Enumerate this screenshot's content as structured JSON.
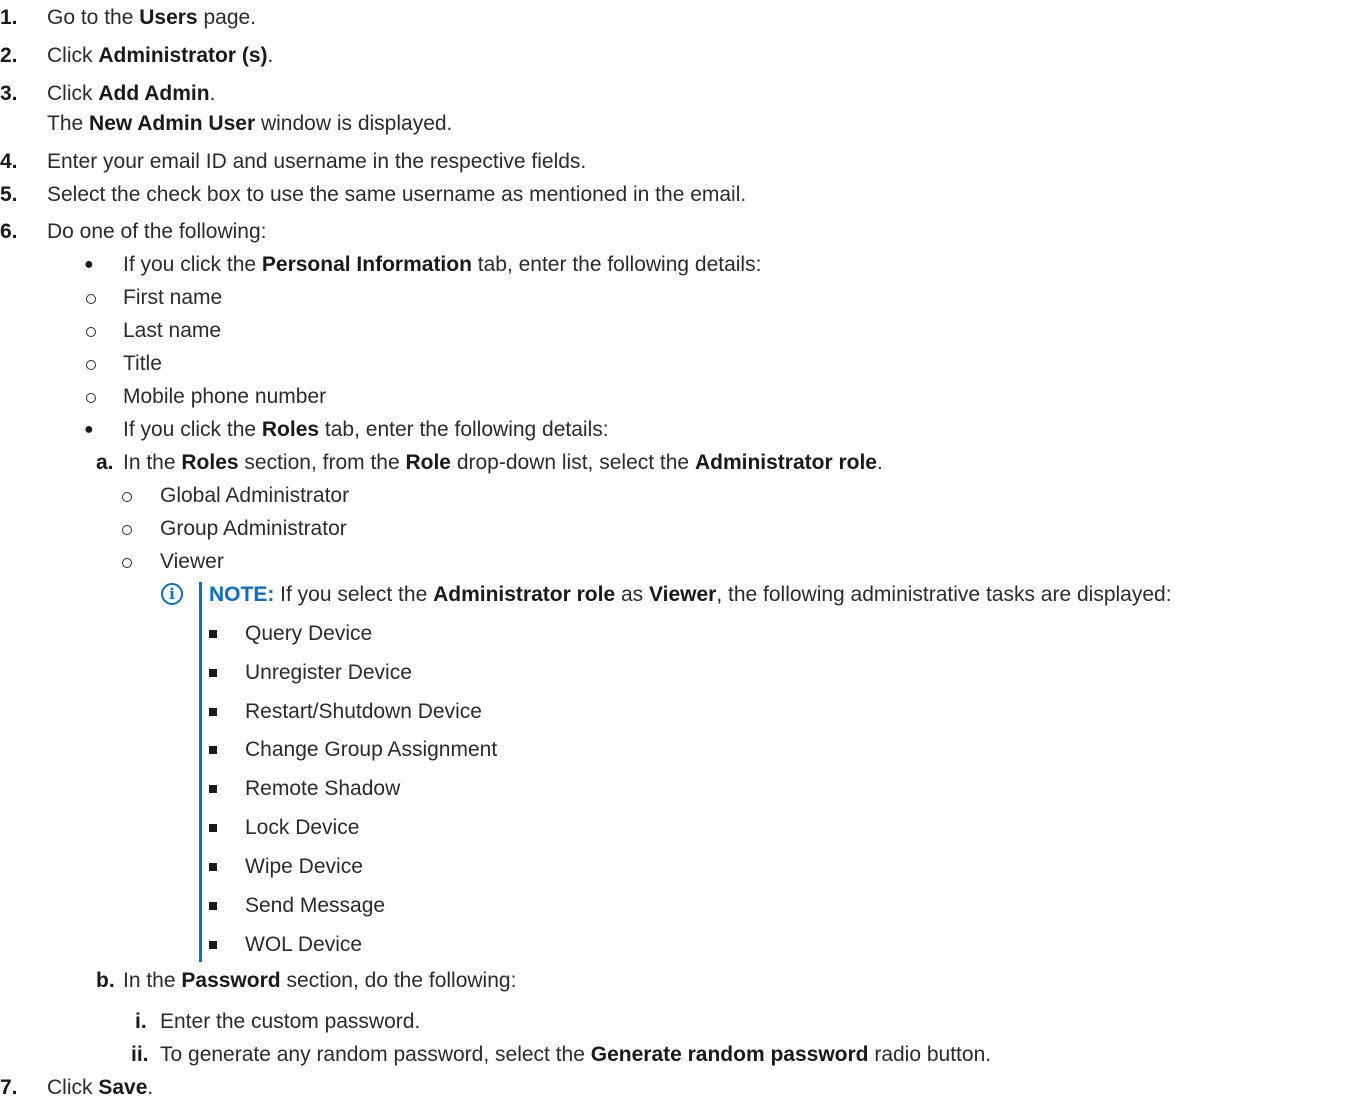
{
  "steps": {
    "s1": {
      "num": "1.",
      "pre": "Go to the ",
      "b1": "Users",
      "post": " page."
    },
    "s2": {
      "num": "2.",
      "pre": "Click ",
      "b1": "Administrator (s)",
      "post": "."
    },
    "s3": {
      "num": "3.",
      "pre": "Click ",
      "b1": "Add Admin",
      "post": ".",
      "sub_pre": "The ",
      "sub_b": "New Admin User",
      "sub_post": " window is displayed."
    },
    "s4": {
      "num": "4.",
      "text": "Enter your email ID and username in the respective fields."
    },
    "s5": {
      "num": "5.",
      "text": "Select the check box to use the same username as mentioned in the email."
    },
    "s6": {
      "num": "6.",
      "text": "Do one of the following:"
    },
    "s7": {
      "num": "7.",
      "pre": "Click ",
      "b1": "Save",
      "post": "."
    }
  },
  "personal": {
    "pre": "If you click the ",
    "b1": "Personal Information",
    "post": " tab, enter the following details:",
    "items": [
      "First name",
      "Last name",
      "Title",
      "Mobile phone number"
    ]
  },
  "roles": {
    "pre": "If you click the ",
    "b1": "Roles",
    "post": " tab, enter the following details:",
    "a": {
      "letter": "a.",
      "t1": "In the ",
      "b1": "Roles",
      "t2": " section, from the ",
      "b2": "Role",
      "t3": " drop-down list, select the ",
      "b3": "Administrator role",
      "t4": "."
    },
    "role_items": [
      "Global Administrator",
      "Group Administrator",
      "Viewer"
    ],
    "note": {
      "label": "NOTE:",
      "t1": " If you select the ",
      "b1": "Administrator role",
      "t2": " as ",
      "b2": "Viewer",
      "t3": ", the following administrative tasks are displayed:"
    },
    "tasks": [
      "Query Device",
      "Unregister Device",
      "Restart/Shutdown Device",
      "Change Group Assignment",
      "Remote Shadow",
      "Lock Device",
      "Wipe Device",
      "Send Message",
      "WOL Device"
    ],
    "b": {
      "letter": "b.",
      "t1": "In the ",
      "b1": "Password",
      "t2": " section, do the following:"
    },
    "i": {
      "letter": "i.",
      "text": "Enter the custom password."
    },
    "ii": {
      "letter": "ii.",
      "t1": "To generate any random password, select the ",
      "b1": "Generate random password",
      "t2": " radio button."
    }
  },
  "colors": {
    "note_accent": "#0a6ed1",
    "text": "#2b2b2b"
  }
}
